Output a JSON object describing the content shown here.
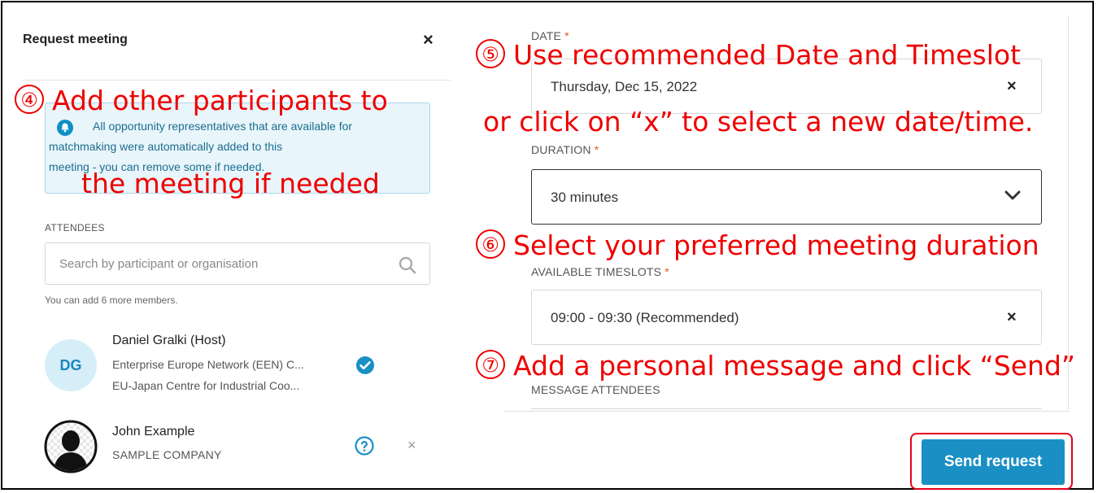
{
  "modal": {
    "title": "Request meeting",
    "close_label": "×",
    "info_line1": "All opportunity representatives that are available for",
    "info_line2": "matchmaking were automatically added to this",
    "info_line3": "meeting - you can remove some if needed.",
    "attendees_label": "ATTENDEES",
    "search_placeholder": "Search by participant or organisation",
    "helper_text": "You can add 6 more members."
  },
  "participants": [
    {
      "initials": "DG",
      "name": "Daniel Gralki  (Host)",
      "org1": "Enterprise Europe Network (EEN) C...",
      "org2": "EU-Japan Centre for Industrial Coo..."
    },
    {
      "name": "John Example",
      "org": "SAMPLE COMPANY",
      "remove_label": "×"
    }
  ],
  "form": {
    "date_label": "DATE",
    "date_value": "Thursday, Dec 15, 2022",
    "duration_label": "DURATION",
    "duration_value": "30 minutes",
    "timeslots_label": "AVAILABLE TIMESLOTS",
    "timeslot_value": "09:00 - 09:30 (Recommended)",
    "message_label": "MESSAGE ATTENDEES",
    "required_marker": "*",
    "clear_label": "×",
    "send_button": "Send request"
  },
  "annotations": {
    "step4_num": "④",
    "step4_line1": "Add other participants to",
    "step4_line2": "the meeting if needed",
    "step5_num": "⑤",
    "step5_line1": "Use recommended  Date and Timeslot",
    "step5_line2": "or click on “x” to select a new date/time.",
    "step6_num": "⑥",
    "step6_text": "Select your preferred meeting duration",
    "step7_num": "⑦",
    "step7_text": "Add a personal message and click “Send”"
  },
  "colors": {
    "accent": "#1a8fc4",
    "annotation": "#ee0000",
    "required": "#e05a1a",
    "info_bg": "#e8f5fb"
  }
}
